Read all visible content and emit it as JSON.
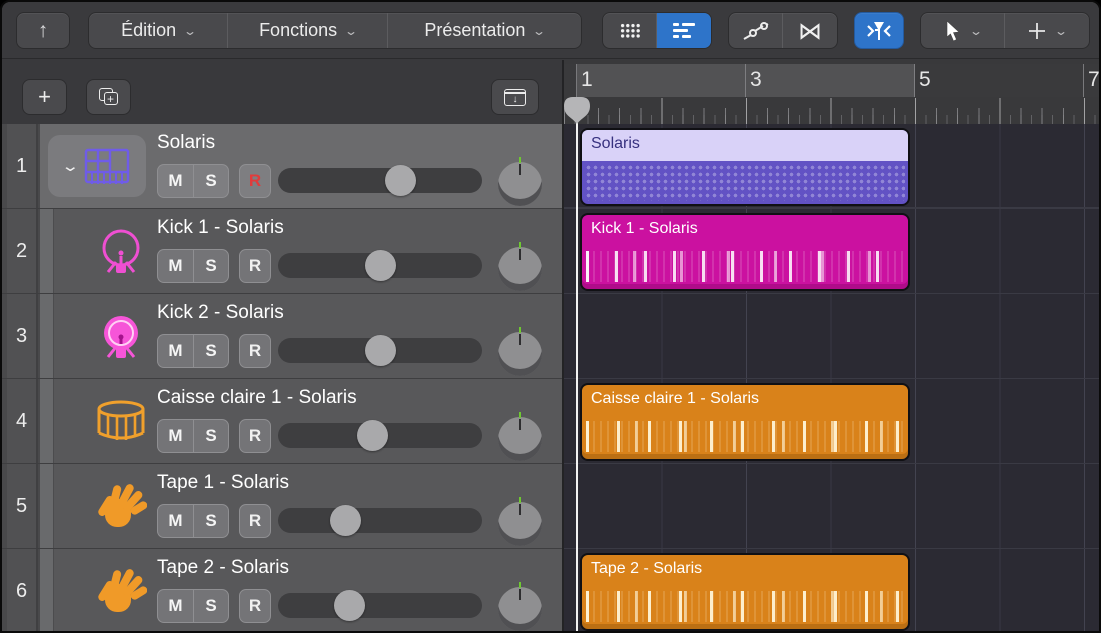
{
  "toolbar": {
    "back_button": {
      "icon": "up-arrow",
      "glyph": "↑"
    },
    "menus": [
      {
        "label": "Édition"
      },
      {
        "label": "Fonctions"
      },
      {
        "label": "Présentation"
      }
    ],
    "view_toggle": {
      "grid_view_active": false,
      "list_view_active": true
    },
    "automation_buttons": [
      "automation-curve",
      "midi-draw"
    ],
    "midi_draw_glyph": "⋈",
    "catch_playhead": {
      "active": true
    },
    "tools": [
      "pointer-tool",
      "pencil-crosshair-tool"
    ],
    "accent_blue": "#2e74c9"
  },
  "track_toolbar": {
    "add_track_label": "+",
    "buttons": [
      "add-track",
      "duplicate-track",
      "track-header-config"
    ]
  },
  "ruler": {
    "bar_numbers": [
      "1",
      "3",
      "5",
      "7"
    ],
    "highlighted_bars": "1-5",
    "playhead_bar": "1"
  },
  "tracks": [
    {
      "num": "1",
      "name": "Solaris",
      "icon": "drum-machine-designer-grid",
      "icon_color": "#6f5ce8",
      "selected": true,
      "is_parent": true,
      "m": "M",
      "s": "S",
      "r": "R",
      "record_enabled": true,
      "volume_pct": 60,
      "pan": "center"
    },
    {
      "num": "2",
      "name": "Kick 1 - Solaris",
      "icon": "kick-drum-outline",
      "icon_color": "#ef4fd2",
      "selected": false,
      "m": "M",
      "s": "S",
      "r": "R",
      "record_enabled": false,
      "volume_pct": 50,
      "pan": "center"
    },
    {
      "num": "3",
      "name": "Kick 2 - Solaris",
      "icon": "kick-drum-filled",
      "icon_color": "#f655d8",
      "selected": false,
      "m": "M",
      "s": "S",
      "r": "R",
      "record_enabled": false,
      "volume_pct": 50,
      "pan": "center"
    },
    {
      "num": "4",
      "name": "Caisse claire 1 - Solaris",
      "icon": "snare-drum",
      "icon_color": "#f0a02c",
      "selected": false,
      "m": "M",
      "s": "S",
      "r": "R",
      "record_enabled": false,
      "volume_pct": 46,
      "pan": "center"
    },
    {
      "num": "5",
      "name": "Tape 1 - Solaris",
      "icon": "hand-clap",
      "icon_color": "#f09a28",
      "selected": false,
      "m": "M",
      "s": "S",
      "r": "R",
      "record_enabled": false,
      "volume_pct": 33,
      "pan": "center"
    },
    {
      "num": "6",
      "name": "Tape 2 - Solaris",
      "icon": "hand-clap",
      "icon_color": "#f09a28",
      "selected": false,
      "m": "M",
      "s": "S",
      "r": "R",
      "record_enabled": false,
      "volume_pct": 35,
      "pan": "center"
    }
  ],
  "regions": [
    {
      "track_row": 0,
      "label": "Solaris",
      "style": "pattern",
      "color_header": "#d9d2f8",
      "color_body": "#6252c4",
      "span": "bars 1-5"
    },
    {
      "track_row": 1,
      "label": "Kick 1 - Solaris",
      "style": "midi-notes",
      "color": "#cb11a0",
      "span": "bars 1-5"
    },
    {
      "track_row": 3,
      "label": "Caisse claire 1 - Solaris",
      "style": "midi-notes",
      "color": "#d9821a",
      "span": "bars 1-5"
    },
    {
      "track_row": 5,
      "label": "Tape 2 - Solaris",
      "style": "midi-notes",
      "color": "#d9821a",
      "span": "bars 1-5"
    }
  ]
}
